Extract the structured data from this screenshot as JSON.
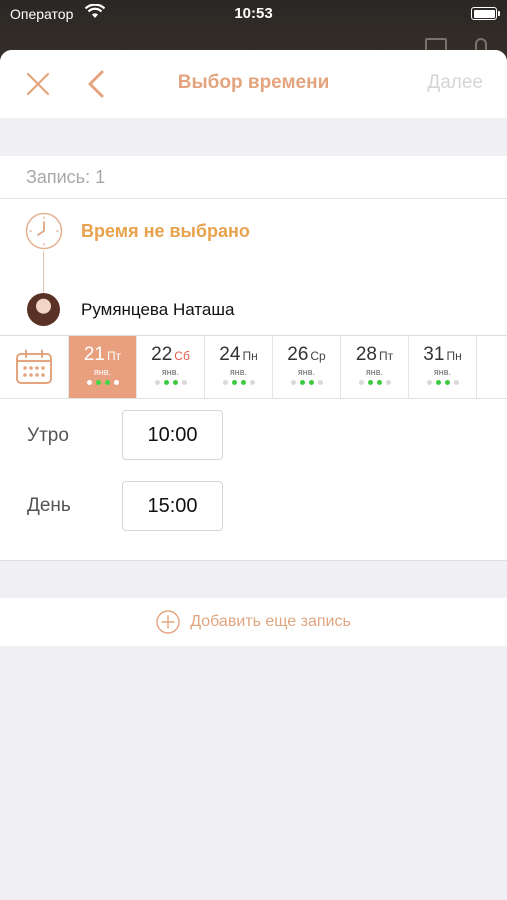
{
  "status_bar": {
    "carrier": "Оператор",
    "time": "10:53"
  },
  "nav": {
    "title": "Выбор времени",
    "next_label": "Далее"
  },
  "record": {
    "header": "Запись: 1",
    "time_status": "Время не выбрано",
    "master_name": "Румянцева Наташа"
  },
  "dates": [
    {
      "day": "21",
      "dow": "Пт",
      "month": "янв.",
      "selected": true,
      "weekend": false,
      "dots": [
        "grey",
        "green",
        "green",
        "grey"
      ]
    },
    {
      "day": "22",
      "dow": "Сб",
      "month": "янв.",
      "selected": false,
      "weekend": true,
      "dots": [
        "grey",
        "green",
        "green",
        "grey"
      ]
    },
    {
      "day": "24",
      "dow": "Пн",
      "month": "янв.",
      "selected": false,
      "weekend": false,
      "dots": [
        "grey",
        "green",
        "green",
        "grey"
      ]
    },
    {
      "day": "26",
      "dow": "Ср",
      "month": "янв.",
      "selected": false,
      "weekend": false,
      "dots": [
        "grey",
        "green",
        "green",
        "grey"
      ]
    },
    {
      "day": "28",
      "dow": "Пт",
      "month": "янв.",
      "selected": false,
      "weekend": false,
      "dots": [
        "grey",
        "green",
        "green",
        "grey"
      ]
    },
    {
      "day": "31",
      "dow": "Пн",
      "month": "янв.",
      "selected": false,
      "weekend": false,
      "dots": [
        "grey",
        "green",
        "green",
        "grey"
      ]
    }
  ],
  "slots": [
    {
      "label": "Утро",
      "time": "10:00"
    },
    {
      "label": "День",
      "time": "15:00"
    }
  ],
  "add_record_label": "Добавить еще запись",
  "colors": {
    "accent": "#e3a47e",
    "status_orange": "#e8a24e",
    "available_green": "#3ecb3e",
    "weekend_red": "#e05a4a"
  },
  "icons": [
    "wifi-icon",
    "battery-icon",
    "close-icon",
    "back-chevron-icon",
    "clock-icon",
    "calendar-icon",
    "plus-circle-icon"
  ]
}
